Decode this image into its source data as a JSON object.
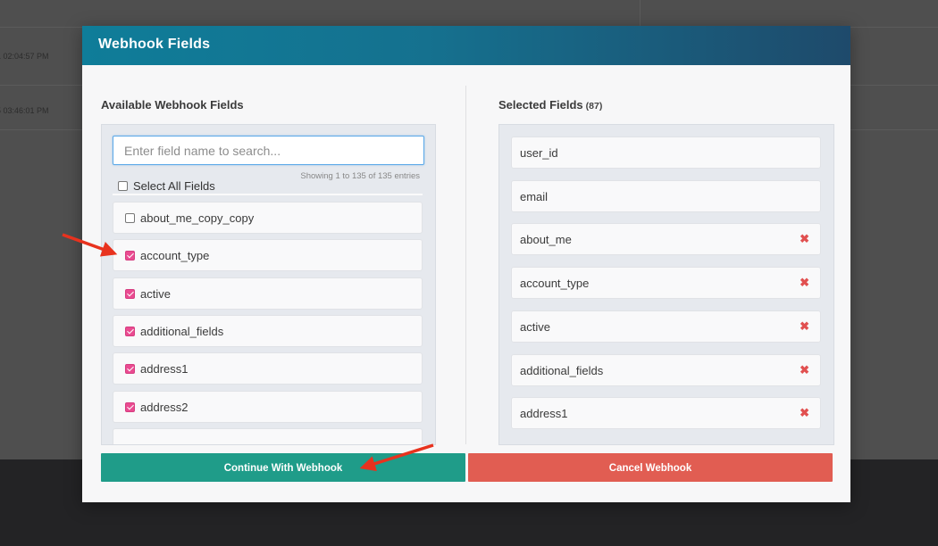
{
  "background": {
    "timestamps": [
      "1 02:04:57 PM",
      "5 03:46:01 PM"
    ]
  },
  "modal": {
    "title": "Webhook Fields",
    "available": {
      "title": "Available Webhook Fields",
      "search_placeholder": "Enter field name to search...",
      "showing_text": "Showing 1 to 135 of 135 entries",
      "select_all_label": "Select All Fields",
      "items": [
        {
          "label": "about_me_copy_copy",
          "checked": false
        },
        {
          "label": "account_type",
          "checked": true
        },
        {
          "label": "active",
          "checked": true
        },
        {
          "label": "additional_fields",
          "checked": true
        },
        {
          "label": "address1",
          "checked": true
        },
        {
          "label": "address2",
          "checked": true
        }
      ]
    },
    "selected": {
      "title": "Selected Fields",
      "count": "(87)",
      "items": [
        {
          "label": "user_id",
          "removable": false
        },
        {
          "label": "email",
          "removable": false
        },
        {
          "label": "about_me",
          "removable": true
        },
        {
          "label": "account_type",
          "removable": true
        },
        {
          "label": "active",
          "removable": true
        },
        {
          "label": "additional_fields",
          "removable": true
        },
        {
          "label": "address1",
          "removable": true
        }
      ],
      "remove_glyph": "✖"
    },
    "buttons": {
      "continue_label": "Continue With Webhook",
      "cancel_label": "Cancel Webhook"
    }
  },
  "colors": {
    "header_start": "#0f7d99",
    "header_end": "#1e4a6b",
    "checkbox_checked": "#ea4b91",
    "continue_button": "#1f9c89",
    "cancel_button": "#e15d52",
    "remove_icon": "#e15050",
    "annotation_arrow": "#e8321e"
  }
}
